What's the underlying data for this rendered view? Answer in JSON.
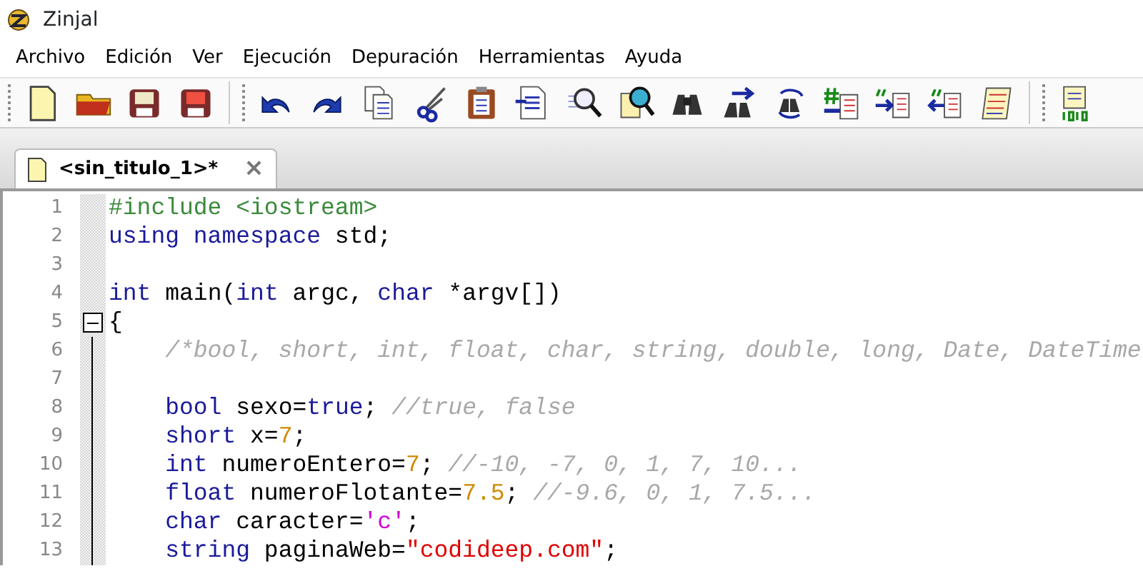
{
  "window": {
    "title": "Zinjal"
  },
  "menu": [
    {
      "label": "Archivo"
    },
    {
      "label": "Edición"
    },
    {
      "label": "Ver"
    },
    {
      "label": "Ejecución"
    },
    {
      "label": "Depuración"
    },
    {
      "label": "Herramientas"
    },
    {
      "label": "Ayuda"
    }
  ],
  "tabs": [
    {
      "label": "<sin_titulo_1>*",
      "selected": true,
      "close": "×"
    }
  ],
  "editor": {
    "lines": [
      {
        "number": "1",
        "tokens": [
          {
            "kind": "preproc",
            "text": "#include <iostream>"
          }
        ]
      },
      {
        "number": "2",
        "tokens": [
          {
            "kind": "keyword",
            "text": "using namespace"
          },
          {
            "kind": "plain",
            "text": " std;"
          }
        ]
      },
      {
        "number": "3"
      },
      {
        "number": "4",
        "tokens": [
          {
            "kind": "keyword",
            "text": "int"
          },
          {
            "kind": "plain",
            "text": " main("
          },
          {
            "kind": "keyword",
            "text": "int"
          },
          {
            "kind": "plain",
            "text": " argc, "
          },
          {
            "kind": "keyword",
            "text": "char"
          },
          {
            "kind": "plain",
            "text": " *argv[])"
          }
        ]
      },
      {
        "number": "5",
        "fold": {
          "kind": "start",
          "expanded": true
        },
        "tokens": [
          {
            "kind": "plain",
            "text": "{"
          }
        ]
      },
      {
        "number": "6",
        "fold": {
          "kind": "line"
        },
        "tokens": [
          {
            "kind": "comment",
            "text": "    /*bool, short, int, float, char, string, double, long, Date, DateTime"
          }
        ]
      },
      {
        "number": "7",
        "fold": {
          "kind": "line"
        }
      },
      {
        "number": "8",
        "fold": {
          "kind": "line"
        },
        "tokens": [
          {
            "kind": "keyword",
            "text": "    bool"
          },
          {
            "kind": "plain",
            "text": " sexo="
          },
          {
            "kind": "keyword",
            "text": "true"
          },
          {
            "kind": "plain",
            "text": "; "
          },
          {
            "kind": "comment",
            "text": "//true, false"
          }
        ]
      },
      {
        "number": "9",
        "fold": {
          "kind": "line"
        },
        "tokens": [
          {
            "kind": "keyword",
            "text": "    short"
          },
          {
            "kind": "plain",
            "text": " x="
          },
          {
            "kind": "number",
            "text": "7"
          },
          {
            "kind": "plain",
            "text": ";"
          }
        ]
      },
      {
        "number": "10",
        "fold": {
          "kind": "line"
        },
        "tokens": [
          {
            "kind": "keyword",
            "text": "    int"
          },
          {
            "kind": "plain",
            "text": " numeroEntero="
          },
          {
            "kind": "number",
            "text": "7"
          },
          {
            "kind": "plain",
            "text": "; "
          },
          {
            "kind": "comment",
            "text": "//-10, -7, 0, 1, 7, 10..."
          }
        ]
      },
      {
        "number": "11",
        "fold": {
          "kind": "line"
        },
        "tokens": [
          {
            "kind": "keyword",
            "text": "    float"
          },
          {
            "kind": "plain",
            "text": " numeroFlotante="
          },
          {
            "kind": "number",
            "text": "7.5"
          },
          {
            "kind": "plain",
            "text": "; "
          },
          {
            "kind": "comment",
            "text": "//-9.6, 0, 1, 7.5..."
          }
        ]
      },
      {
        "number": "12",
        "fold": {
          "kind": "line"
        },
        "tokens": [
          {
            "kind": "keyword",
            "text": "    char"
          },
          {
            "kind": "plain",
            "text": " caracter="
          },
          {
            "kind": "char",
            "text": "'c'"
          },
          {
            "kind": "plain",
            "text": ";"
          }
        ]
      },
      {
        "number": "13",
        "fold": {
          "kind": "line"
        },
        "tokens": [
          {
            "kind": "keyword",
            "text": "    string"
          },
          {
            "kind": "plain",
            "text": " paginaWeb="
          },
          {
            "kind": "string",
            "text": "\"codideep.com\""
          },
          {
            "kind": "plain",
            "text": ";"
          }
        ]
      }
    ]
  }
}
